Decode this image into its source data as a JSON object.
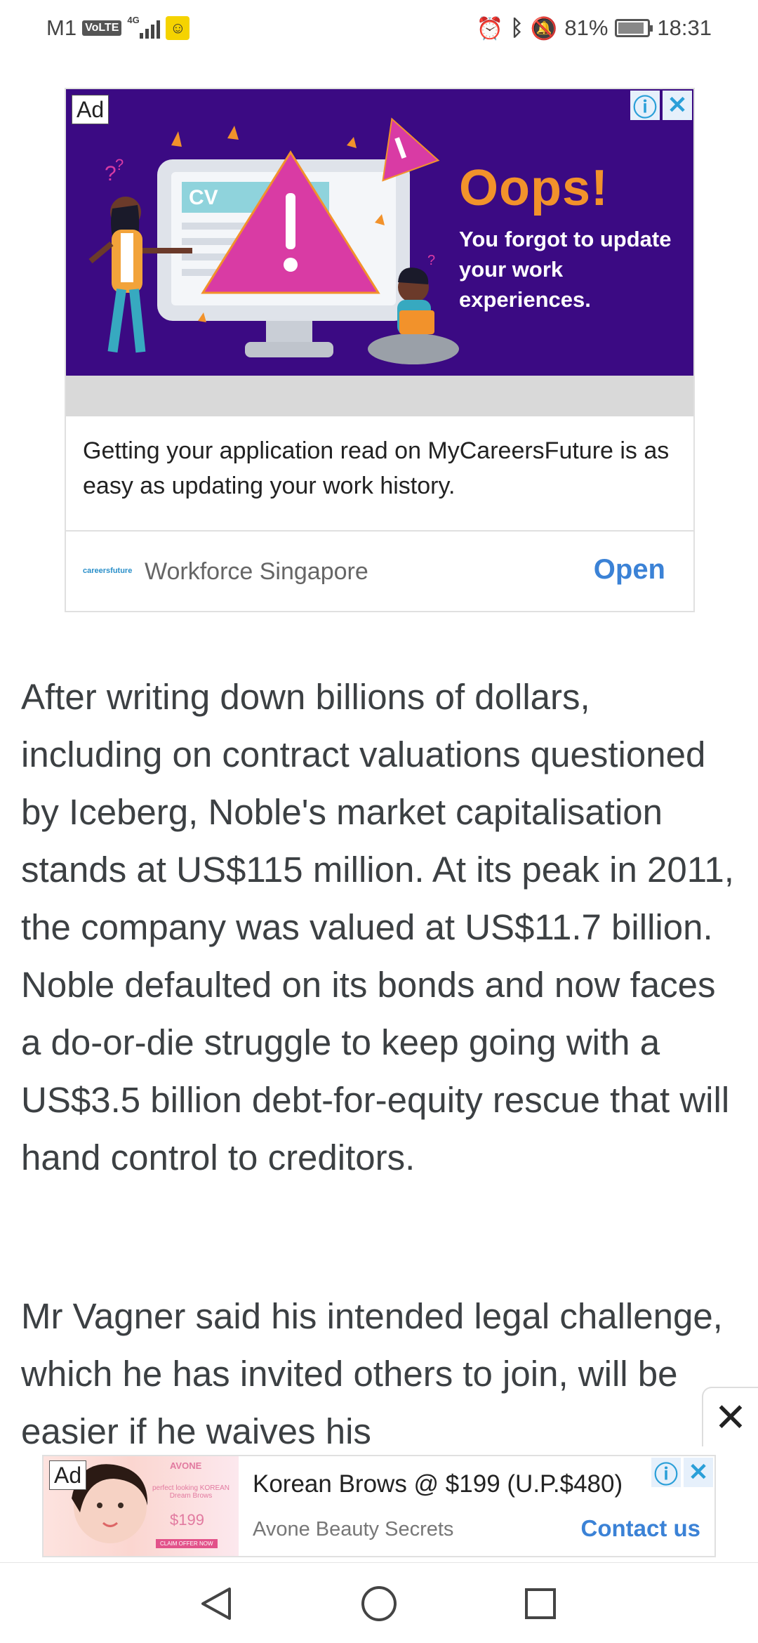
{
  "status_bar": {
    "carrier": "M1",
    "volte": "VoLTE",
    "network": "4G",
    "battery": "81%",
    "time": "18:31"
  },
  "top_ad": {
    "badge": "Ad",
    "headline": "Oops!",
    "subheadline": "You forgot to update your work experiences.",
    "cv_label": "CV",
    "description": "Getting your application read on MyCareersFuture is as easy as updating your work history.",
    "brand_logo": "careersfuture",
    "brand": "Workforce Singapore",
    "cta": "Open",
    "accent": "#3b0a83"
  },
  "article": {
    "paragraph1": "After writing down billions of dollars, including on contract valuations questioned by Iceberg, Noble's market capitalisation stands at US$115 million. At its peak in 2011, the company was valued at US$11.7 billion. Noble defaulted on its bonds and now faces a do-or-die struggle to keep going with a US$3.5 billion debt-for-equity rescue that will hand control to creditors.",
    "paragraph2": "Mr Vagner said his intended legal challenge, which he has invited others to join, will be easier if he waives his"
  },
  "bottom_ad": {
    "badge": "Ad",
    "thumb_brand": "AVONE",
    "thumb_text": "perfect looking KOREAN Dream Brows",
    "thumb_price": "$199",
    "thumb_cta": "CLAIM OFFER NOW",
    "title": "Korean Brows @ $199 (U.P.$480)",
    "brand": "Avone Beauty Secrets",
    "cta": "Contact us"
  },
  "icons": {
    "float_close": "close-icon",
    "nav_back": "back-triangle-icon",
    "nav_home": "home-circle-icon",
    "nav_recent": "recent-square-icon"
  }
}
